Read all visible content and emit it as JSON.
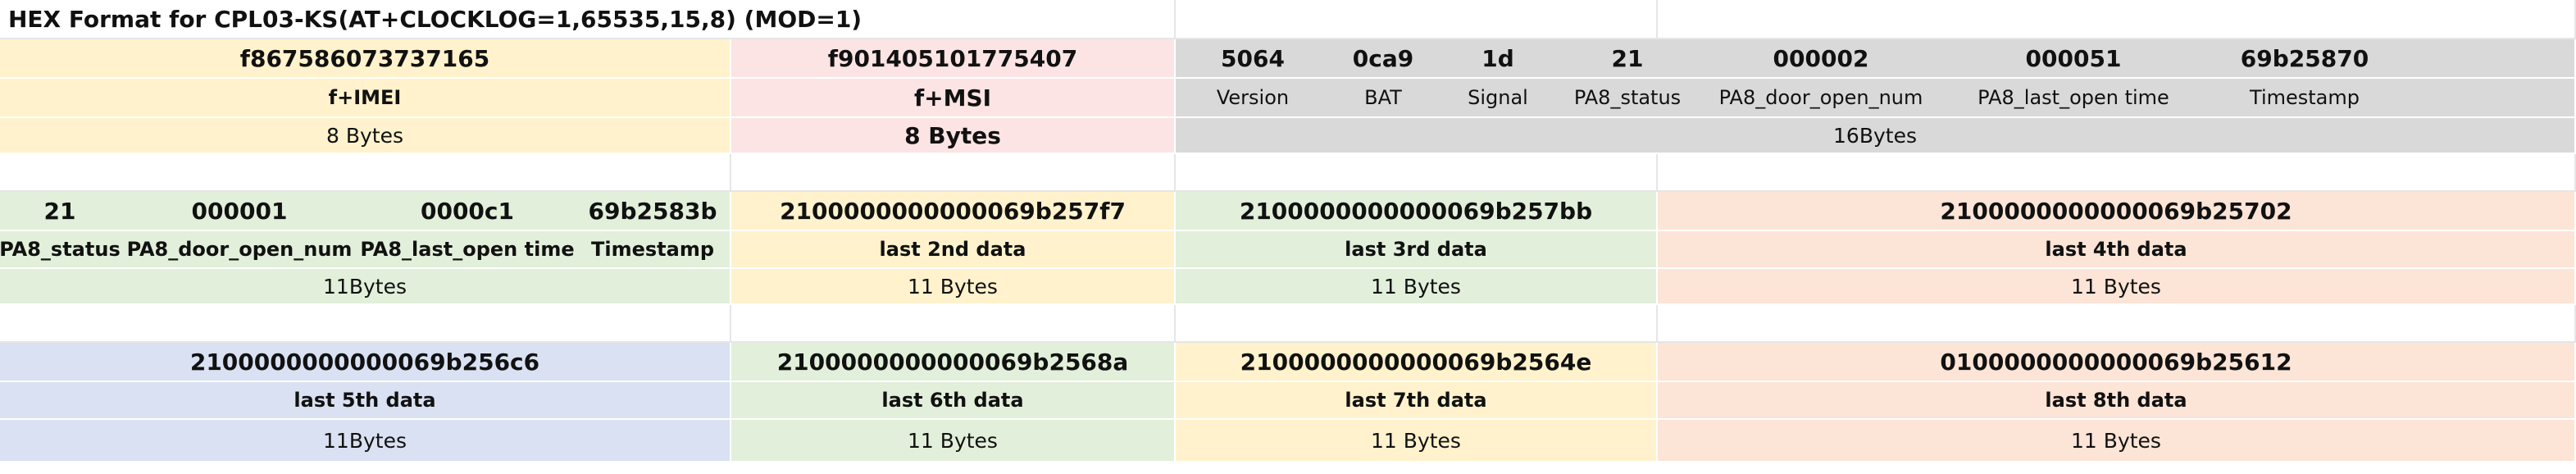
{
  "title": "HEX Format for CPL03-KS(AT+CLOCKLOG=1,65535,15,8)  (MOD=1)",
  "section1": {
    "imei": {
      "value": "f867586073737165",
      "label": "f+IMEI",
      "size": "8 Bytes"
    },
    "imsi": {
      "value": "f901405101775407",
      "label": "f+MSI",
      "size": "8 Bytes"
    },
    "fields": [
      {
        "value": "5064",
        "label": "Version"
      },
      {
        "value": "0ca9",
        "label": "BAT"
      },
      {
        "value": "1d",
        "label": "Signal"
      },
      {
        "value": "21",
        "label": "PA8_status"
      },
      {
        "value": "000002",
        "label": "PA8_door_open_num"
      },
      {
        "value": "000051",
        "label": "PA8_last_open time"
      },
      {
        "value": "69b25870",
        "label": "Timestamp"
      }
    ],
    "fields_size": "16Bytes"
  },
  "section2": {
    "first": {
      "fields": [
        {
          "value": "21",
          "label": "PA8_status"
        },
        {
          "value": "000001",
          "label": "PA8_door_open_num"
        },
        {
          "value": "0000c1",
          "label": "PA8_last_open time"
        },
        {
          "value": "69b2583b",
          "label": "Timestamp"
        }
      ],
      "size": "11Bytes"
    },
    "blocks": [
      {
        "value": "2100000000000069b257f7",
        "label": "last 2nd data",
        "size": "11 Bytes"
      },
      {
        "value": "2100000000000069b257bb",
        "label": "last 3rd data",
        "size": "11 Bytes"
      },
      {
        "value": "2100000000000069b25702",
        "label": "last 4th data",
        "size": "11 Bytes"
      }
    ]
  },
  "section3": {
    "blocks": [
      {
        "value": "2100000000000069b256c6",
        "label": "last 5th data",
        "size": "11Bytes"
      },
      {
        "value": "2100000000000069b2568a",
        "label": "last 6th data",
        "size": "11 Bytes"
      },
      {
        "value": "2100000000000069b2564e",
        "label": "last 7th data",
        "size": "11 Bytes"
      },
      {
        "value": "0100000000000069b25612",
        "label": "last 8th data",
        "size": "11 Bytes"
      }
    ]
  },
  "colors": {
    "yellow": "#fff2cc",
    "pink": "#fce4e4",
    "gray": "#d9d9d9",
    "green": "#e2efda",
    "orange": "#fce4d6",
    "blue": "#d9e1f2"
  }
}
